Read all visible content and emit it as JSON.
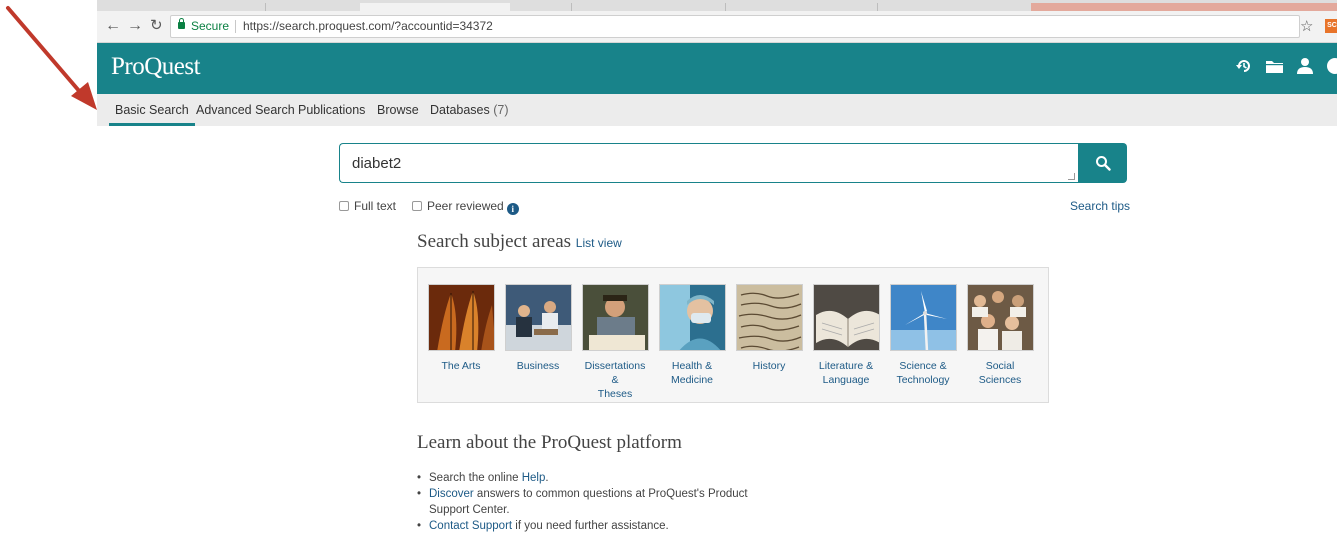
{
  "browser": {
    "secure_label": "Secure",
    "url": "https://search.proquest.com/?accountid=34372",
    "extension_badge": "SC"
  },
  "header": {
    "logo": "ProQuest",
    "icons": [
      "history-icon",
      "folder-icon",
      "user-icon"
    ]
  },
  "nav": {
    "tabs": [
      {
        "label": "Basic Search",
        "active": true
      },
      {
        "label": "Advanced Search"
      },
      {
        "label": "Publications"
      },
      {
        "label": "Browse"
      },
      {
        "label": "Databases",
        "count": "(7)"
      }
    ]
  },
  "search": {
    "value": "diabet2",
    "fulltext_label": "Full text",
    "peer_label": "Peer reviewed",
    "tips": "Search tips"
  },
  "subjects": {
    "title": "Search subject areas",
    "list_view": "List view",
    "items": [
      {
        "line1": "The Arts",
        "line2": ""
      },
      {
        "line1": "Business",
        "line2": ""
      },
      {
        "line1": "Dissertations &",
        "line2": "Theses"
      },
      {
        "line1": "Health &",
        "line2": "Medicine"
      },
      {
        "line1": "History",
        "line2": ""
      },
      {
        "line1": "Literature &",
        "line2": "Language"
      },
      {
        "line1": "Science &",
        "line2": "Technology"
      },
      {
        "line1": "Social Sciences",
        "line2": ""
      }
    ]
  },
  "learn": {
    "title": "Learn about the ProQuest platform",
    "item1_pre": "Search the online ",
    "item1_link": "Help",
    "item1_post": ".",
    "item2_link": "Discover",
    "item2_post": " answers to common questions at ProQuest's Product Support Center.",
    "item3_link": "Contact Support",
    "item3_post": " if you need further assistance."
  },
  "colors": {
    "brand": "#18838a",
    "link": "#1d5a86",
    "annotation_arrow": "#c0392b"
  }
}
